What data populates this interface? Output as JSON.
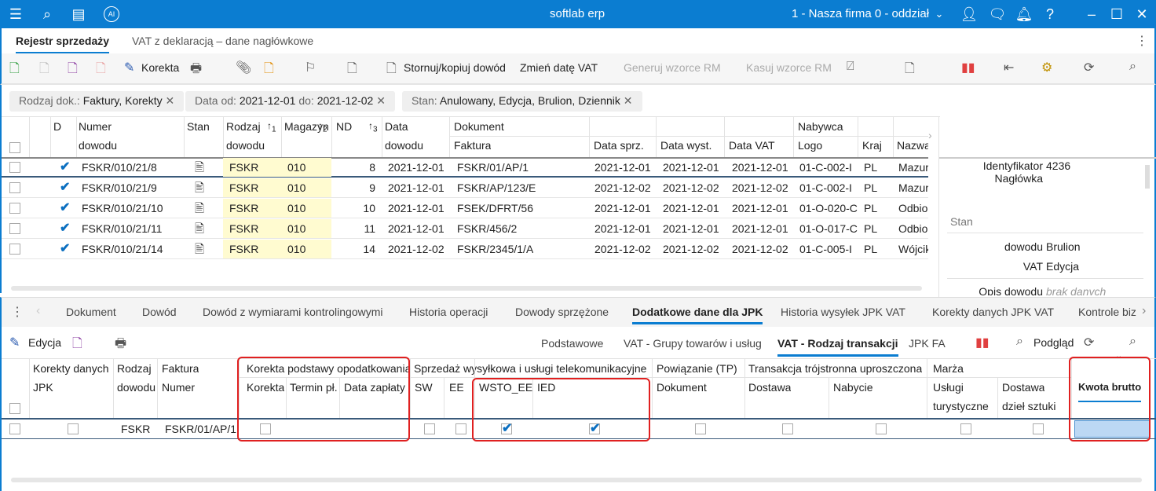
{
  "app": {
    "title": "softlab erp",
    "company": "1 - Nasza firma 0 - oddział",
    "ai_badge": "AI"
  },
  "tabs": [
    {
      "label": "Rejestr sprzedaży",
      "active": true
    },
    {
      "label": "VAT z deklaracją – dane nagłówkowe",
      "active": false
    }
  ],
  "toolbar": {
    "korekta": "Korekta",
    "stornuj": "Stornuj/kopiuj dowód",
    "zmien_date": "Zmień datę VAT",
    "generuj": "Generuj wzorce RM",
    "kasuj": "Kasuj wzorce RM"
  },
  "filters": [
    {
      "label": "Rodzaj dok.:",
      "value": "Faktury, Korekty"
    },
    {
      "label": "Data od:",
      "value": "2021-12-01",
      "label2": "do:",
      "value2": "2021-12-02"
    },
    {
      "label": "Stan:",
      "value": "Anulowany, Edycja, Brulion, Dziennik"
    }
  ],
  "grid": {
    "group_headers": {
      "dokument": "Dokument",
      "nabywca": "Nabywca"
    },
    "columns": [
      "D",
      "Numer dowodu",
      "Stan",
      "Rodzaj dowodu",
      "Magazyn",
      "ND",
      "Data dowodu",
      "Faktura",
      "Data sprz.",
      "Data wyst.",
      "Data VAT",
      "Logo",
      "Kraj",
      "Nazwa"
    ],
    "col_lines": [
      [
        "Numer",
        "dowodu"
      ],
      [
        "Rodzaj",
        "dowodu"
      ],
      [
        "Data",
        "dowodu"
      ]
    ],
    "sort_marks": [
      "1",
      "2",
      "3"
    ],
    "rows": [
      {
        "d": true,
        "numer": "FSKR/010/21/8",
        "rodzaj": "FSKR",
        "magazyn": "010",
        "nd": "8",
        "data": "2021-12-01",
        "faktura": "FSKR/01/AP/1",
        "sprz": "2021-12-01",
        "wyst": "2021-12-01",
        "vat": "2021-12-01",
        "logo": "01-C-002-I",
        "kraj": "PL",
        "nazwa": "Mazur Te"
      },
      {
        "d": true,
        "numer": "FSKR/010/21/9",
        "rodzaj": "FSKR",
        "magazyn": "010",
        "nd": "9",
        "data": "2021-12-01",
        "faktura": "FSKR/AP/123/E",
        "sprz": "2021-12-02",
        "wyst": "2021-12-02",
        "vat": "2021-12-02",
        "logo": "01-C-002-I",
        "kraj": "PL",
        "nazwa": "Mazur Te"
      },
      {
        "d": true,
        "numer": "FSKR/010/21/10",
        "rodzaj": "FSKR",
        "magazyn": "010",
        "nd": "10",
        "data": "2021-12-01",
        "faktura": "FSEK/DFRT/56",
        "sprz": "2021-12-01",
        "wyst": "2021-12-01",
        "vat": "2021-12-01",
        "logo": "01-O-020-C",
        "kraj": "PL",
        "nazwa": "Odbiorca"
      },
      {
        "d": true,
        "numer": "FSKR/010/21/11",
        "rodzaj": "FSKR",
        "magazyn": "010",
        "nd": "11",
        "data": "2021-12-01",
        "faktura": "FSKR/456/2",
        "sprz": "2021-12-01",
        "wyst": "2021-12-01",
        "vat": "2021-12-01",
        "logo": "01-O-017-C",
        "kraj": "PL",
        "nazwa": "Odbiorca"
      },
      {
        "d": true,
        "numer": "FSKR/010/21/14",
        "rodzaj": "FSKR",
        "magazyn": "010",
        "nd": "14",
        "data": "2021-12-02",
        "faktura": "FSKR/2345/1/A",
        "sprz": "2021-12-02",
        "wyst": "2021-12-02",
        "vat": "2021-12-02",
        "logo": "01-C-005-I",
        "kraj": "PL",
        "nazwa": "Wójcik A"
      }
    ]
  },
  "details": {
    "id_label1": "Identyfikator",
    "id_label2": "Nagłówka",
    "id_value": "4236",
    "stan_section": "Stan",
    "dowodu_label": "dowodu",
    "dowodu_value": "Brulion",
    "vat_label": "VAT",
    "vat_value": "Edycja",
    "opis_label": "Opis dowodu",
    "opis_value": "brak danych"
  },
  "lower_tabs": [
    "Dokument",
    "Dowód",
    "Dowód z wymiarami kontrolingowymi",
    "Historia operacji",
    "Dowody sprzężone",
    "Dodatkowe dane dla JPK",
    "Historia wysyłek JPK VAT",
    "Korekty danych JPK VAT",
    "Kontrole biz"
  ],
  "lower_active_tab": "Dodatkowe dane dla JPK",
  "lower_toolbar": {
    "edycja": "Edycja",
    "subtabs": [
      "Podstawowe",
      "VAT - Grupy towarów i usług",
      "VAT - Rodzaj transakcji",
      "JPK FA"
    ],
    "active_subtab": "VAT - Rodzaj transakcji",
    "podglad": "Podgląd"
  },
  "lower_grid": {
    "headers": {
      "korekty1": "Korekty danych",
      "korekty2": "JPK",
      "rodzaj1": "Rodzaj",
      "rodzaj2": "dowodu",
      "faktura1": "Faktura",
      "faktura2": "Numer",
      "g_korekta": "Korekta podstawy opodatkowania",
      "korekta": "Korekta",
      "termin": "Termin pł.",
      "data_zaplaty": "Data zapłaty",
      "g_sprzedaz": "Sprzedaż wysyłkowa i usługi telekomunikacyjne",
      "sw": "SW",
      "ee": "EE",
      "wsto": "WSTO_EE",
      "ied": "IED",
      "g_powiazanie": "Powiązanie (TP)",
      "dokument": "Dokument",
      "g_trans": "Transakcja trójstronna uproszczona",
      "dostawa": "Dostawa",
      "nabycie": "Nabycie",
      "g_marza": "Marża",
      "uslugi1": "Usługi",
      "uslugi2": "turystyczne",
      "dziel1": "Dostawa",
      "dziel2": "dzieł sztuki",
      "kwota": "Kwota brutto"
    },
    "row": {
      "rodzaj": "FSKR",
      "faktura": "FSKR/01/AP/1",
      "korekty_jpk": false,
      "korekta": false,
      "sw": false,
      "ee": false,
      "wsto_ee": true,
      "ied": true,
      "dokument": false,
      "dostawa": false,
      "nabycie": false,
      "uslugi": false,
      "dziela": false,
      "kwota": ""
    }
  },
  "colors": {
    "accent": "#0b7dd1",
    "highlight": "#fffbd0",
    "annotation": "#e02020"
  }
}
